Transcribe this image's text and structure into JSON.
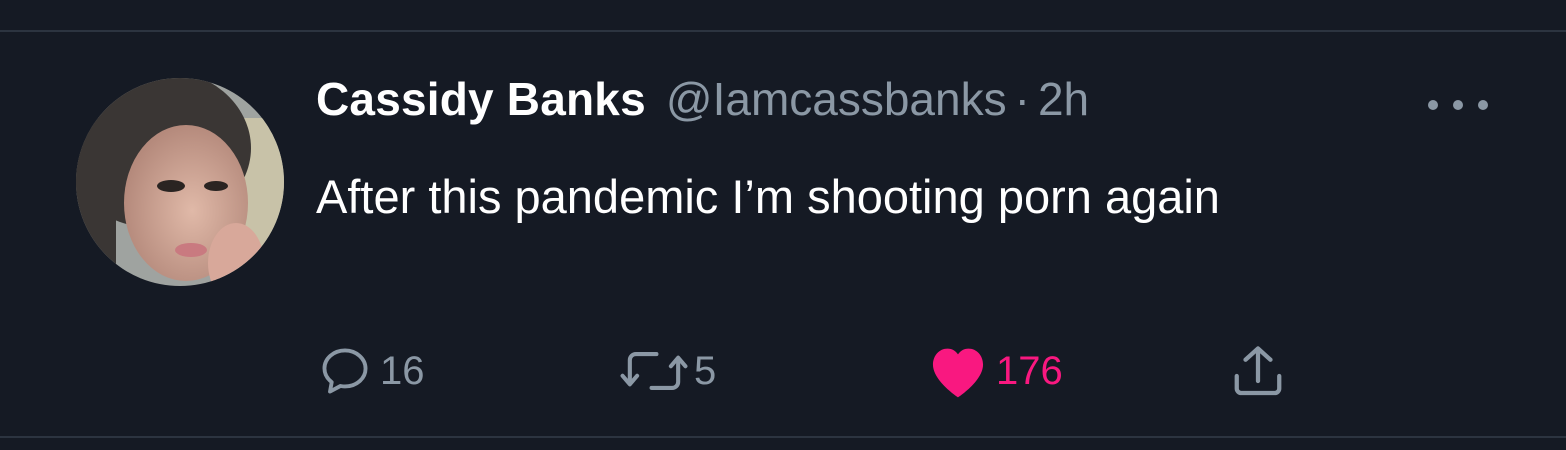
{
  "tweet": {
    "author_name": "Cassidy Banks",
    "handle": "@Iamcassbanks",
    "separator": "·",
    "time": "2h",
    "text": "After this pandemic I’m shooting porn again"
  },
  "actions": {
    "reply_count": "16",
    "retweet_count": "5",
    "like_count": "176"
  },
  "colors": {
    "background": "#151a24",
    "text_primary": "#ffffff",
    "text_secondary": "#8b98a5",
    "like": "#f91880",
    "divider": "#2c3440"
  },
  "icons": {
    "more": "more-horizontal-icon",
    "reply": "reply-icon",
    "retweet": "retweet-icon",
    "like": "heart-icon",
    "share": "share-icon"
  }
}
